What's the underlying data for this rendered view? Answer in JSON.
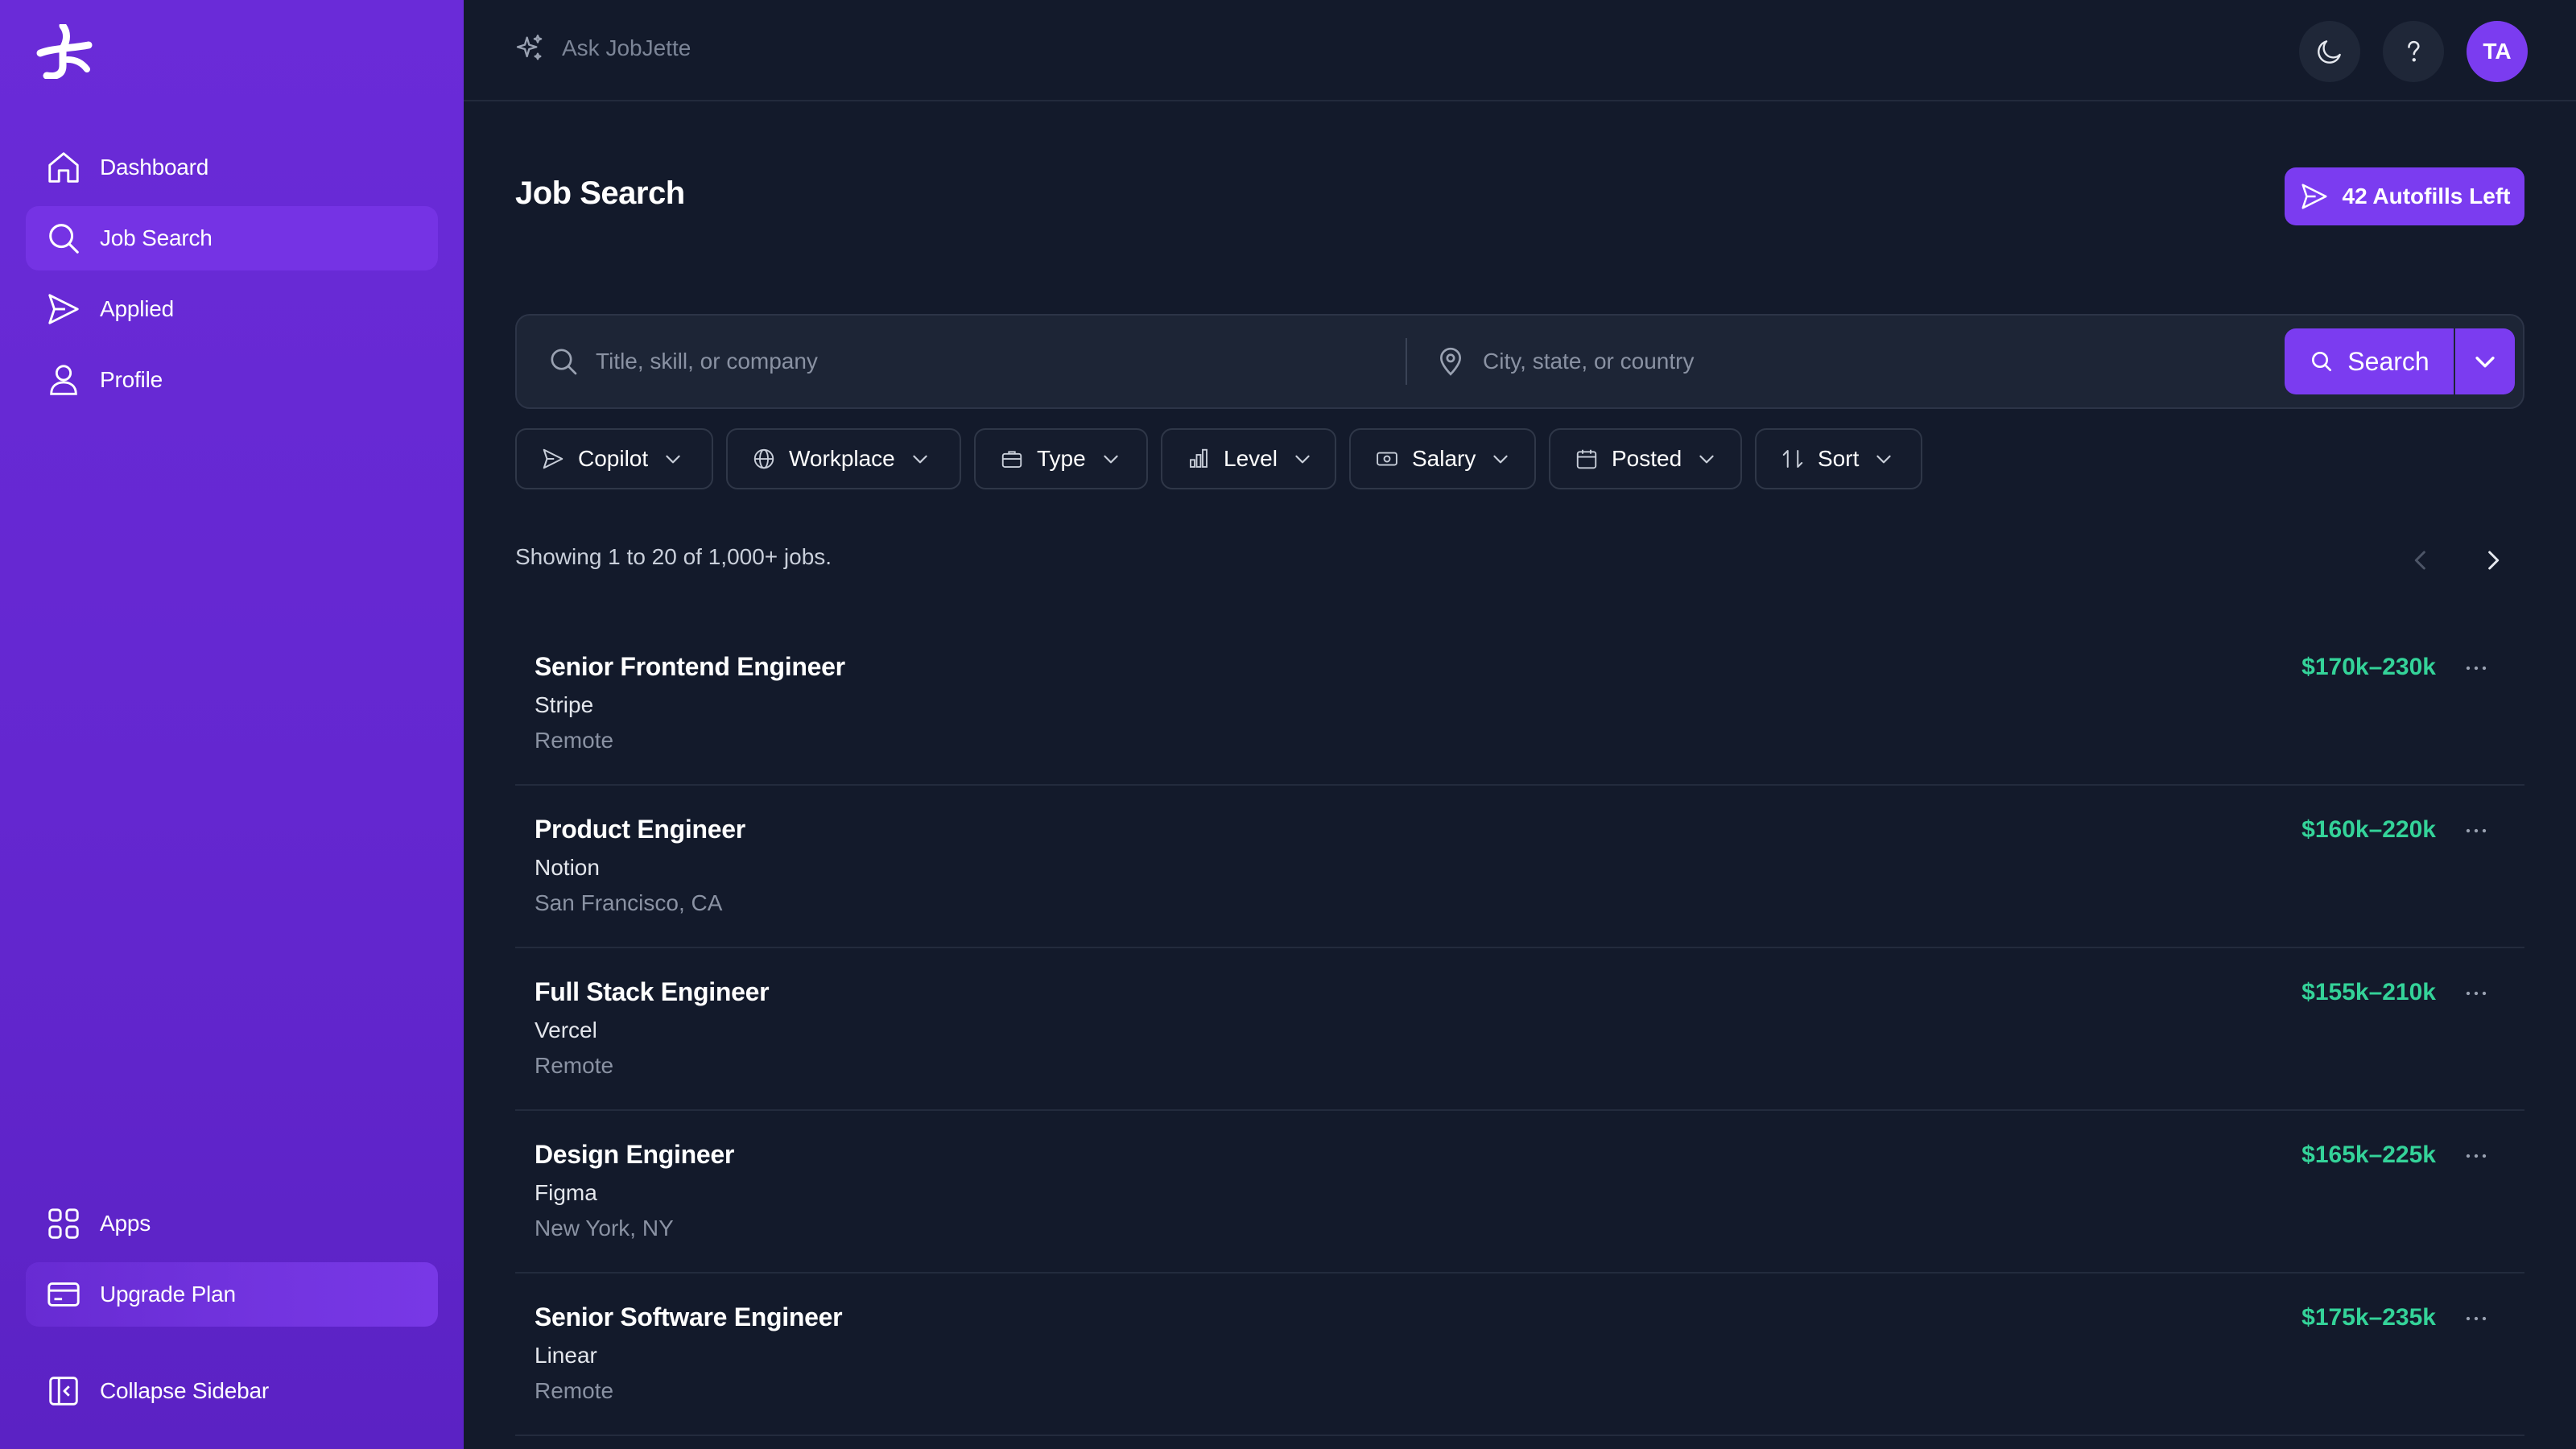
{
  "sidebar": {
    "nav": [
      {
        "label": "Dashboard",
        "icon": "home-icon"
      },
      {
        "label": "Job Search",
        "icon": "search-icon",
        "active": true
      },
      {
        "label": "Applied",
        "icon": "send-icon"
      },
      {
        "label": "Profile",
        "icon": "user-icon"
      }
    ],
    "bottom": [
      {
        "label": "Apps",
        "icon": "apps-grid-icon"
      },
      {
        "label": "Upgrade Plan",
        "icon": "credit-card-icon"
      }
    ],
    "collapse_label": "Collapse Sidebar"
  },
  "topbar": {
    "ask_label": "Ask JobJette",
    "avatar_initials": "TA"
  },
  "main": {
    "title": "Job Search",
    "autofills_label": "42 Autofills Left",
    "search": {
      "query_placeholder": "Title, skill, or company",
      "query_value": "",
      "location_placeholder": "City, state, or country",
      "location_value": "",
      "button_label": "Search"
    },
    "filters": [
      {
        "label": "Copilot",
        "icon": "send-icon"
      },
      {
        "label": "Workplace",
        "icon": "globe-icon"
      },
      {
        "label": "Type",
        "icon": "briefcase-icon"
      },
      {
        "label": "Level",
        "icon": "bar-chart-icon"
      },
      {
        "label": "Salary",
        "icon": "banknote-icon"
      },
      {
        "label": "Posted",
        "icon": "calendar-icon"
      },
      {
        "label": "Sort",
        "icon": "sort-arrows-icon"
      }
    ],
    "results_text": "Showing 1 to 20 of 1,000+ jobs.",
    "jobs": [
      {
        "title": "Senior Frontend Engineer",
        "company": "Stripe",
        "location": "Remote",
        "salary": "$170k–230k"
      },
      {
        "title": "Product Engineer",
        "company": "Notion",
        "location": "San Francisco, CA",
        "salary": "$160k–220k"
      },
      {
        "title": "Full Stack Engineer",
        "company": "Vercel",
        "location": "Remote",
        "salary": "$155k–210k"
      },
      {
        "title": "Design Engineer",
        "company": "Figma",
        "location": "New York, NY",
        "salary": "$165k–225k"
      },
      {
        "title": "Senior Software Engineer",
        "company": "Linear",
        "location": "Remote",
        "salary": "$175k–235k"
      }
    ]
  },
  "colors": {
    "sidebar": "#6a2bd8",
    "accent": "#7b3cf0",
    "background": "#131a2b",
    "salary": "#34d399"
  }
}
